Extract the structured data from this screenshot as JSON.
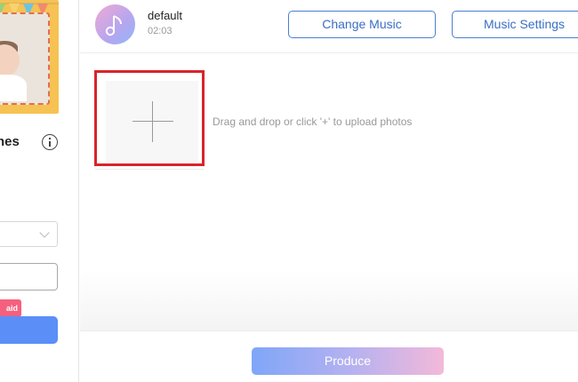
{
  "sidebar": {
    "theme_title": "hes",
    "paid_badge": "aid"
  },
  "music": {
    "name": "default",
    "duration": "02:03",
    "change_label": "Change Music",
    "settings_label": "Music Settings"
  },
  "upload": {
    "hint": "Drag and drop or click '+' to upload photos"
  },
  "footer": {
    "produce_label": "Produce"
  },
  "colors": {
    "accent_blue": "#4a7fd1",
    "highlight_red": "#d8242b",
    "paid_pink": "#f5607e",
    "primary_blue": "#5b8ef7"
  }
}
